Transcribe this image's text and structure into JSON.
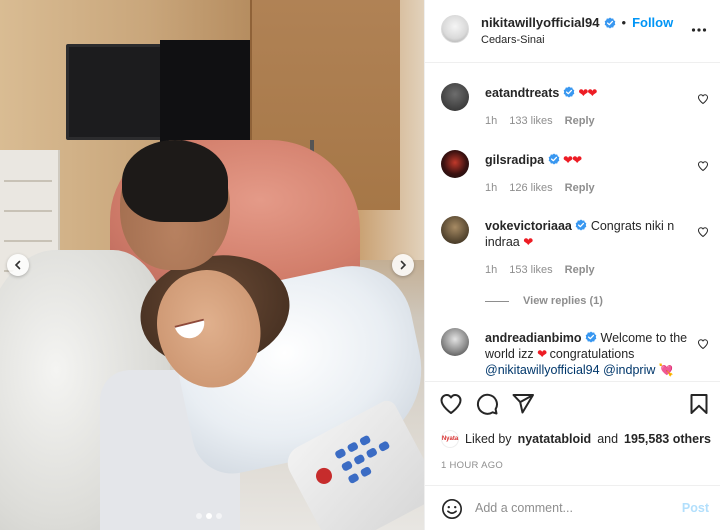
{
  "post": {
    "username": "nikitawillyofficial94",
    "follow_label": "Follow",
    "location": "Cedars-Sinai",
    "separator": "•"
  },
  "comments": [
    {
      "username": "eatandtreats",
      "text": "",
      "hearts": "❤❤",
      "time": "1h",
      "likes": "133 likes",
      "reply": "Reply"
    },
    {
      "username": "gilsradipa",
      "text": "",
      "hearts": "❤❤",
      "time": "1h",
      "likes": "126 likes",
      "reply": "Reply"
    },
    {
      "username": "vokevictoriaaa",
      "text": "Congrats niki n indraa",
      "hearts": "❤",
      "time": "1h",
      "likes": "153 likes",
      "reply": "Reply"
    },
    {
      "username": "andreadianbimo",
      "text_1": "Welcome to the world izz",
      "hearts": "❤",
      "text_2": "congratulations",
      "mention_1": "@nikitawillyofficial94",
      "mention_2": "@indpriw",
      "emoji": "💘"
    }
  ],
  "view_replies": "View replies (1)",
  "likes": {
    "prefix": "Liked by",
    "liker": "nyatatabloid",
    "and": "and",
    "others": "195,583 others",
    "liker_avatar_text": "Nyata"
  },
  "timestamp": "1 HOUR AGO",
  "add_comment": {
    "placeholder": "Add a comment...",
    "post_label": "Post"
  },
  "colors": {
    "link_blue": "#0095f6",
    "verified_blue": "#3897f0",
    "heart_red": "#ed1c24",
    "post_disabled": "#b2dffc"
  },
  "icons": [
    "verified-badge-icon",
    "more-options-icon",
    "heart-icon",
    "comment-icon",
    "share-icon",
    "bookmark-icon",
    "emoji-icon",
    "chevron-left-icon",
    "chevron-right-icon"
  ]
}
